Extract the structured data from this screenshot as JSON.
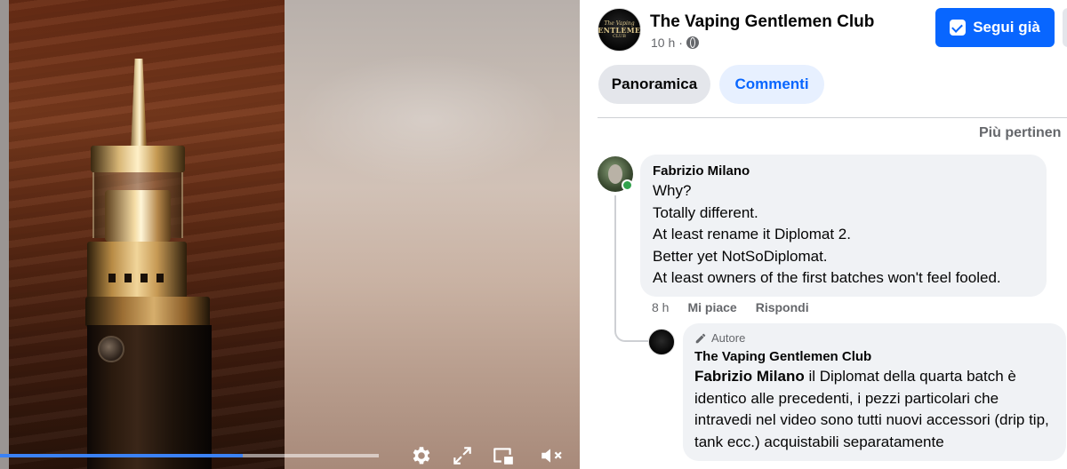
{
  "video": {
    "progress_fraction": 0.64,
    "controls": {
      "settings_icon": "gear-icon",
      "fullscreen_icon": "expand-icon",
      "pip_icon": "picture-in-picture-icon",
      "mute_icon": "muted-speaker-icon"
    }
  },
  "post": {
    "page_name": "The Vaping Gentlemen Club",
    "time": "10 h",
    "audience_icon": "globe-icon",
    "follow_label": "Segui già",
    "avatar_text": {
      "l1": "The Vaping",
      "l2": "GENTLEMEN",
      "l3": "CLUB"
    }
  },
  "tabs": [
    {
      "label": "Panoramica"
    },
    {
      "label": "Commenti"
    }
  ],
  "sort": {
    "label": "Più pertinen"
  },
  "comment": {
    "author": "Fabrizio Milano",
    "lines": [
      "Why?",
      "Totally different.",
      "At least rename it Diplomat 2.",
      "Better yet NotSoDiplomat.",
      "At least owners of the first batches won't feel fooled."
    ],
    "time": "8 h",
    "like_label": "Mi piace",
    "reply_label": "Rispondi"
  },
  "reply": {
    "badge": "Autore",
    "author": "The Vaping Gentlemen Club",
    "mention": "Fabrizio Milano",
    "text": " il Diplomat della quarta batch è identico alle precedenti, i pezzi particolari che intravedi nel video sono tutti nuovi accessori (drip tip, tank ecc.) acquistabili separatamente"
  },
  "colors": {
    "accent": "#0866ff",
    "tab_active_bg": "#e7f0ff",
    "bubble_bg": "#f0f2f5",
    "online": "#31a24c",
    "progress": "#3b82f6"
  }
}
